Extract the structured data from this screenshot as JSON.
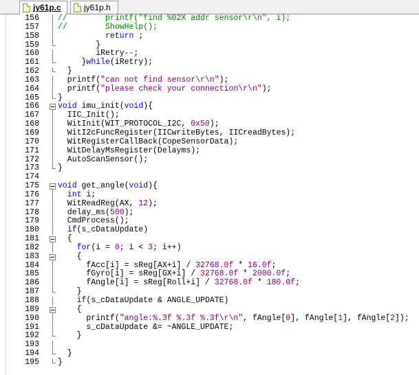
{
  "tabs": [
    {
      "label": "jy61p.c",
      "active": true
    },
    {
      "label": "jy61p.h",
      "active": false
    }
  ],
  "lines": [
    {
      "num": "156",
      "fold": "v",
      "code": [
        {
          "t": "//        printf(\"find %02X addr sensor\\r\\n\", i);",
          "c": "c"
        }
      ]
    },
    {
      "num": "157",
      "fold": "v",
      "code": [
        {
          "t": "//        ShowHelp();",
          "c": "c"
        }
      ]
    },
    {
      "num": "158",
      "fold": "v",
      "code": [
        {
          "t": "          "
        },
        {
          "t": "return",
          "c": "k"
        },
        {
          "t": " ;"
        }
      ]
    },
    {
      "num": "159",
      "fold": "end",
      "code": [
        {
          "t": "        }"
        }
      ]
    },
    {
      "num": "160",
      "fold": "v",
      "code": [
        {
          "t": "        iRetry--;"
        }
      ]
    },
    {
      "num": "161",
      "fold": "end",
      "code": [
        {
          "t": "     }"
        },
        {
          "t": "while",
          "c": "k"
        },
        {
          "t": "(iRetry);"
        }
      ]
    },
    {
      "num": "162",
      "fold": "end",
      "code": [
        {
          "t": "  }"
        }
      ]
    },
    {
      "num": "163",
      "fold": "v",
      "code": [
        {
          "t": "  printf("
        },
        {
          "t": "\"can not find sensor\\r\\n\"",
          "c": "s"
        },
        {
          "t": ");"
        }
      ]
    },
    {
      "num": "164",
      "fold": "v",
      "code": [
        {
          "t": "  printf("
        },
        {
          "t": "\"please check your connection\\r\\n\"",
          "c": "s"
        },
        {
          "t": ");"
        }
      ]
    },
    {
      "num": "165",
      "fold": "end",
      "code": [
        {
          "t": "}"
        }
      ]
    },
    {
      "num": "166",
      "fold": "box",
      "code": [
        {
          "t": "void",
          "c": "k"
        },
        {
          "t": " imu_init("
        },
        {
          "t": "void",
          "c": "k"
        },
        {
          "t": "){"
        }
      ]
    },
    {
      "num": "167",
      "fold": "v",
      "code": [
        {
          "t": "  IIC_Init();"
        }
      ]
    },
    {
      "num": "168",
      "fold": "v",
      "code": [
        {
          "t": "  WitInit(WIT_PROTOCOL_I2C, "
        },
        {
          "t": "0x50",
          "c": "n"
        },
        {
          "t": ");"
        }
      ]
    },
    {
      "num": "169",
      "fold": "v",
      "code": [
        {
          "t": "  WitI2cFuncRegister(IICwriteBytes, IICreadBytes);"
        }
      ]
    },
    {
      "num": "170",
      "fold": "v",
      "code": [
        {
          "t": "  WitRegisterCallBack(CopeSensorData);"
        }
      ]
    },
    {
      "num": "171",
      "fold": "v",
      "code": [
        {
          "t": "  WitDelayMsRegister(Delayms);"
        }
      ]
    },
    {
      "num": "172",
      "fold": "v",
      "code": [
        {
          "t": "  AutoScanSensor();"
        }
      ]
    },
    {
      "num": "173",
      "fold": "end",
      "code": [
        {
          "t": "}"
        }
      ]
    },
    {
      "num": "174",
      "fold": "",
      "code": [
        {
          "t": ""
        }
      ]
    },
    {
      "num": "175",
      "fold": "box",
      "code": [
        {
          "t": "void",
          "c": "k"
        },
        {
          "t": " get_angle("
        },
        {
          "t": "void",
          "c": "k"
        },
        {
          "t": "){"
        }
      ]
    },
    {
      "num": "176",
      "fold": "v",
      "code": [
        {
          "t": "  "
        },
        {
          "t": "int",
          "c": "k"
        },
        {
          "t": " i;"
        }
      ]
    },
    {
      "num": "177",
      "fold": "v",
      "code": [
        {
          "t": "  WitReadReg(AX, "
        },
        {
          "t": "12",
          "c": "n"
        },
        {
          "t": ");"
        }
      ]
    },
    {
      "num": "178",
      "fold": "v",
      "code": [
        {
          "t": "  delay_ms("
        },
        {
          "t": "500",
          "c": "n"
        },
        {
          "t": ");"
        }
      ]
    },
    {
      "num": "179",
      "fold": "v",
      "code": [
        {
          "t": "  CmdProcess();"
        }
      ]
    },
    {
      "num": "180",
      "fold": "v",
      "code": [
        {
          "t": "  "
        },
        {
          "t": "if",
          "c": "k"
        },
        {
          "t": "(s_cDataUpdate)"
        }
      ]
    },
    {
      "num": "181",
      "fold": "box",
      "code": [
        {
          "t": "  {"
        }
      ]
    },
    {
      "num": "182",
      "fold": "v",
      "code": [
        {
          "t": "    "
        },
        {
          "t": "for",
          "c": "k"
        },
        {
          "t": "(i = "
        },
        {
          "t": "0",
          "c": "n"
        },
        {
          "t": "; i < "
        },
        {
          "t": "3",
          "c": "n"
        },
        {
          "t": "; i++)"
        }
      ]
    },
    {
      "num": "183",
      "fold": "box",
      "code": [
        {
          "t": "    {"
        }
      ]
    },
    {
      "num": "184",
      "fold": "v",
      "code": [
        {
          "t": "      fAcc[i] = sReg[AX+i] / "
        },
        {
          "t": "32768.0f",
          "c": "n"
        },
        {
          "t": " * "
        },
        {
          "t": "16.0f",
          "c": "n"
        },
        {
          "t": ";"
        }
      ]
    },
    {
      "num": "185",
      "fold": "v",
      "code": [
        {
          "t": "      fGyro[i] = sReg[GX+i] / "
        },
        {
          "t": "32768.0f",
          "c": "n"
        },
        {
          "t": " * "
        },
        {
          "t": "2000.0f",
          "c": "n"
        },
        {
          "t": ";"
        }
      ]
    },
    {
      "num": "186",
      "fold": "v",
      "code": [
        {
          "t": "      fAngle[i] = sReg[Roll+i] / "
        },
        {
          "t": "32768.0f",
          "c": "n"
        },
        {
          "t": " * "
        },
        {
          "t": "180.0f",
          "c": "n"
        },
        {
          "t": ";"
        }
      ]
    },
    {
      "num": "187",
      "fold": "end",
      "code": [
        {
          "t": "    }"
        }
      ]
    },
    {
      "num": "188",
      "fold": "v",
      "code": [
        {
          "t": "    "
        },
        {
          "t": "if",
          "c": "k"
        },
        {
          "t": "(s_cDataUpdate & ANGLE_UPDATE)"
        }
      ]
    },
    {
      "num": "189",
      "fold": "box",
      "code": [
        {
          "t": "    {"
        }
      ]
    },
    {
      "num": "190",
      "fold": "v",
      "code": [
        {
          "t": "      printf("
        },
        {
          "t": "\"angle:%.3f %.3f %.3f\\r\\n\"",
          "c": "s"
        },
        {
          "t": ", fAngle["
        },
        {
          "t": "0",
          "c": "n"
        },
        {
          "t": "], fAngle["
        },
        {
          "t": "1",
          "c": "n"
        },
        {
          "t": "], fAngle["
        },
        {
          "t": "2",
          "c": "n"
        },
        {
          "t": "]);"
        }
      ]
    },
    {
      "num": "191",
      "fold": "v",
      "code": [
        {
          "t": "      s_cDataUpdate &= ~ANGLE_UPDATE;"
        }
      ]
    },
    {
      "num": "192",
      "fold": "end",
      "code": [
        {
          "t": "    }"
        }
      ]
    },
    {
      "num": "193",
      "fold": "v",
      "code": [
        {
          "t": ""
        }
      ]
    },
    {
      "num": "194",
      "fold": "end",
      "code": [
        {
          "t": "  }"
        }
      ]
    },
    {
      "num": "195",
      "fold": "end",
      "code": [
        {
          "t": "}"
        }
      ]
    }
  ]
}
